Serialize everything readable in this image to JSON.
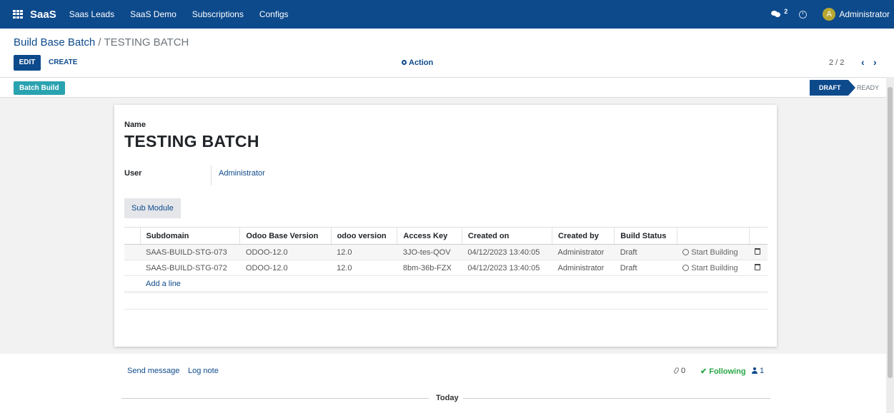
{
  "nav": {
    "brand": "SaaS",
    "menu": [
      "Saas Leads",
      "SaaS Demo",
      "Subscriptions",
      "Configs"
    ],
    "message_count": "2",
    "avatar_initial": "A",
    "user": "Administrator",
    "color": "#0d4a8c"
  },
  "control": {
    "breadcrumb_parent": "Build Base Batch",
    "breadcrumb_sep": " / ",
    "breadcrumb_current": "TESTING BATCH",
    "edit_label": "EDIT",
    "create_label": "CREATE",
    "action_label": "Action",
    "pager": "2 / 2"
  },
  "statusbar": {
    "button_label": "Batch Build",
    "stages": [
      "DRAFT",
      "READY"
    ],
    "active_stage": "DRAFT"
  },
  "form": {
    "name_label": "Name",
    "name": "TESTING BATCH",
    "user_label": "User",
    "user": "Administrator",
    "tab_label": "Sub Module"
  },
  "table": {
    "headers": [
      "Subdomain",
      "Odoo Base Version",
      "odoo version",
      "Access Key",
      "Created on",
      "Created by",
      "Build Status",
      "",
      ""
    ],
    "rows": [
      [
        "SAAS-BUILD-STG-073",
        "ODOO-12.0",
        "12.0",
        "3JO-tes-QOV",
        "04/12/2023 13:40:05",
        "Administrator",
        "Draft",
        "Start Building"
      ],
      [
        "SAAS-BUILD-STG-072",
        "ODOO-12.0",
        "12.0",
        "8bm-36b-FZX",
        "04/12/2023 13:40:05",
        "Administrator",
        "Draft",
        "Start Building"
      ]
    ],
    "add_line": "Add a line"
  },
  "chatter": {
    "send_message": "Send message",
    "log_note": "Log note",
    "attachments": "0",
    "following": "Following",
    "followers": "1",
    "today": "Today"
  }
}
